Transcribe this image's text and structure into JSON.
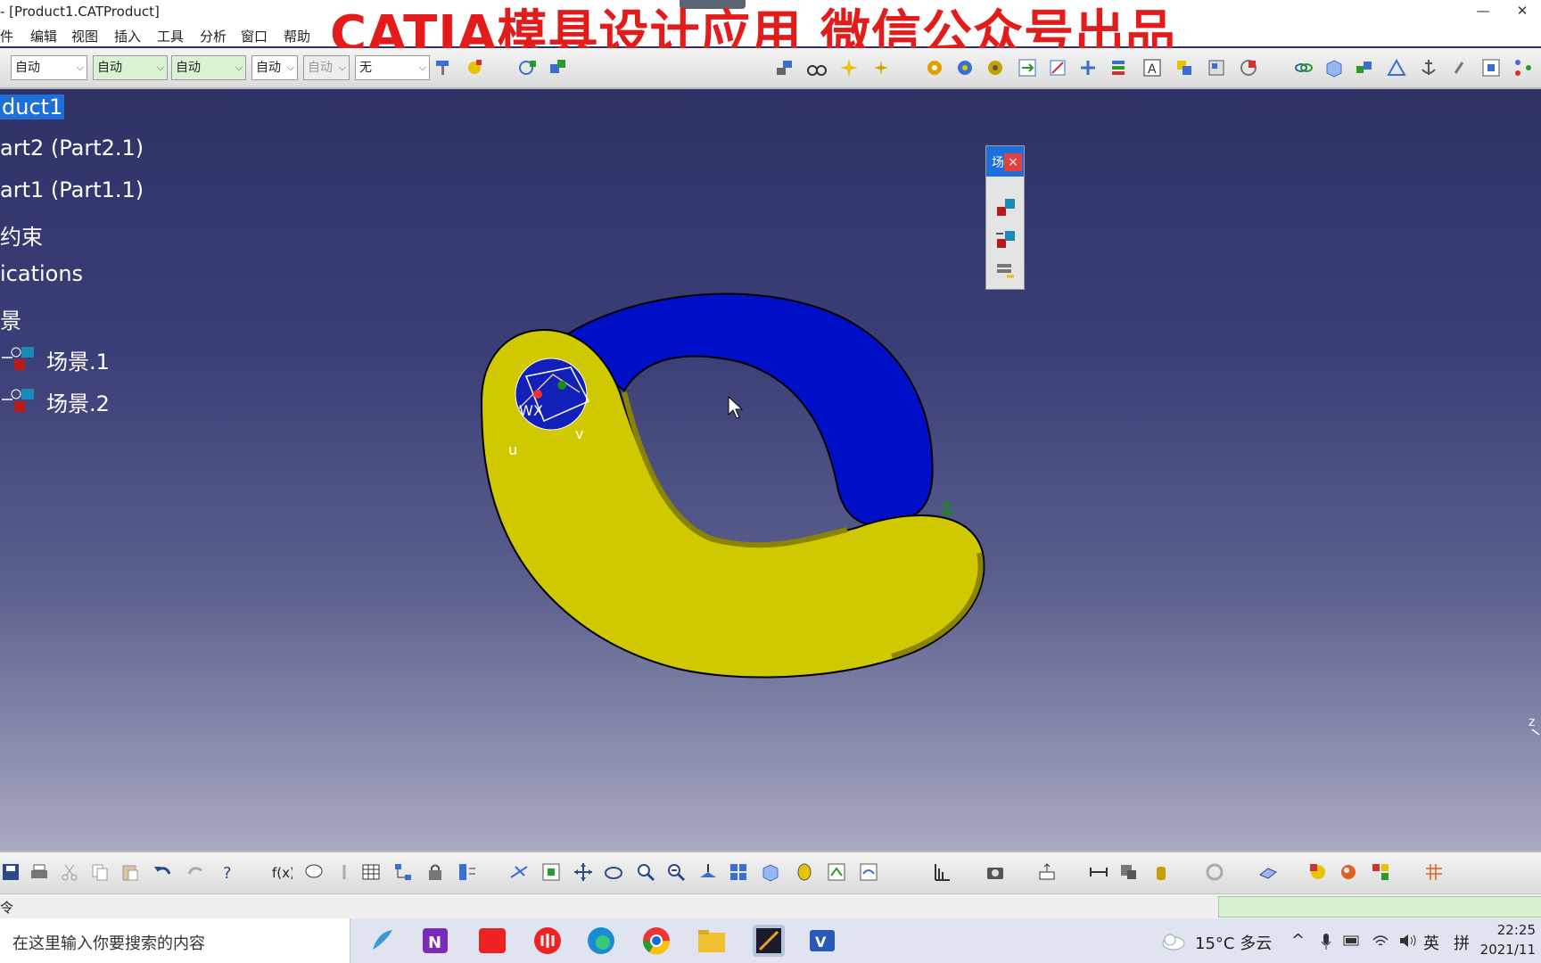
{
  "window": {
    "title": "- [Product1.CATProduct]",
    "minimize_glyph": "—",
    "close_glyph": "✕"
  },
  "menu": [
    "件",
    "编辑",
    "视图",
    "插入",
    "工具",
    "分析",
    "窗口",
    "帮助"
  ],
  "watermark": "CATIA模具设计应用 微信公众号出品",
  "toolbar_top": {
    "combos": [
      {
        "value": "自动",
        "style": "white"
      },
      {
        "value": "自动",
        "style": "green"
      },
      {
        "value": "自动",
        "style": "green"
      },
      {
        "value": "自动",
        "style": "white"
      },
      {
        "value": "自动",
        "style": "gray"
      },
      {
        "value": "无",
        "style": "white"
      }
    ],
    "combo_arrow": "⌵"
  },
  "tree": {
    "items": [
      {
        "label": "duct1",
        "selected": true
      },
      {
        "label": "art2 (Part2.1)",
        "selected": false
      },
      {
        "label": "art1 (Part1.1)",
        "selected": false
      },
      {
        "label": "约束",
        "selected": false
      },
      {
        "label": "ications",
        "selected": false
      },
      {
        "label": "景",
        "selected": false
      },
      {
        "label": "场景.1",
        "selected": false
      },
      {
        "label": "场景.2",
        "selected": false
      }
    ]
  },
  "viewport": {
    "axis_labels": {
      "w": "W",
      "x": "X",
      "u": "u",
      "v": "v",
      "z": "z"
    },
    "colors": {
      "blue_part": "#0010c8",
      "yellow_part": "#d0c800",
      "background_top": "#2f3266",
      "background_bottom": "#a8a9c2"
    }
  },
  "floating_toolbar": {
    "header_glyph": "场",
    "close_glyph": "×"
  },
  "status": {
    "prompt": "令"
  },
  "taskbar": {
    "search_placeholder": "在这里输入你要搜索的内容",
    "weather": "15°C 多云",
    "tray_caret": "^",
    "ime_lang": "英",
    "ime_mode": "拼",
    "time": "22:25",
    "date": "2021/11"
  }
}
